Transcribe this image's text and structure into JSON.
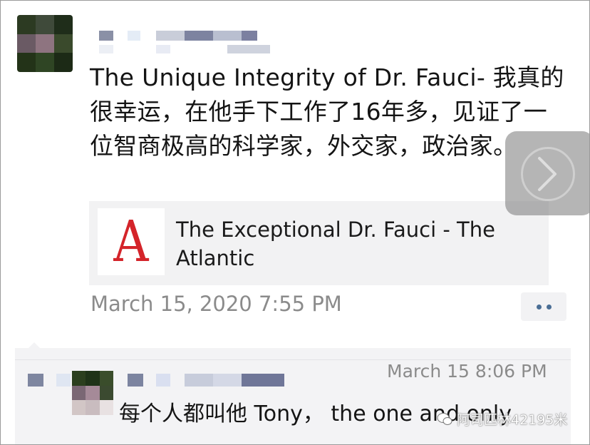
{
  "post": {
    "text": "The Unique Integrity of Dr. Fauci- 我真的很幸运，在他手下工作了16年多，见证了一位智商极高的科学家，外交家，政治家。",
    "link": {
      "thumb_letter": "A",
      "title": "The Exceptional Dr. Fauci - The Atlantic"
    },
    "time": "March 15, 2020 7:55 PM"
  },
  "comment": {
    "time": "March 15 8:06 PM",
    "text": "每个人都叫他 Tony， the one and only"
  },
  "watermark": {
    "text": "阿司匹林42195米"
  },
  "colors": {
    "link_brand": "#d4242a",
    "meta_text": "#8b8b8b",
    "more_dots": "#4a6e95",
    "comment_bg": "#f3f3f5"
  }
}
